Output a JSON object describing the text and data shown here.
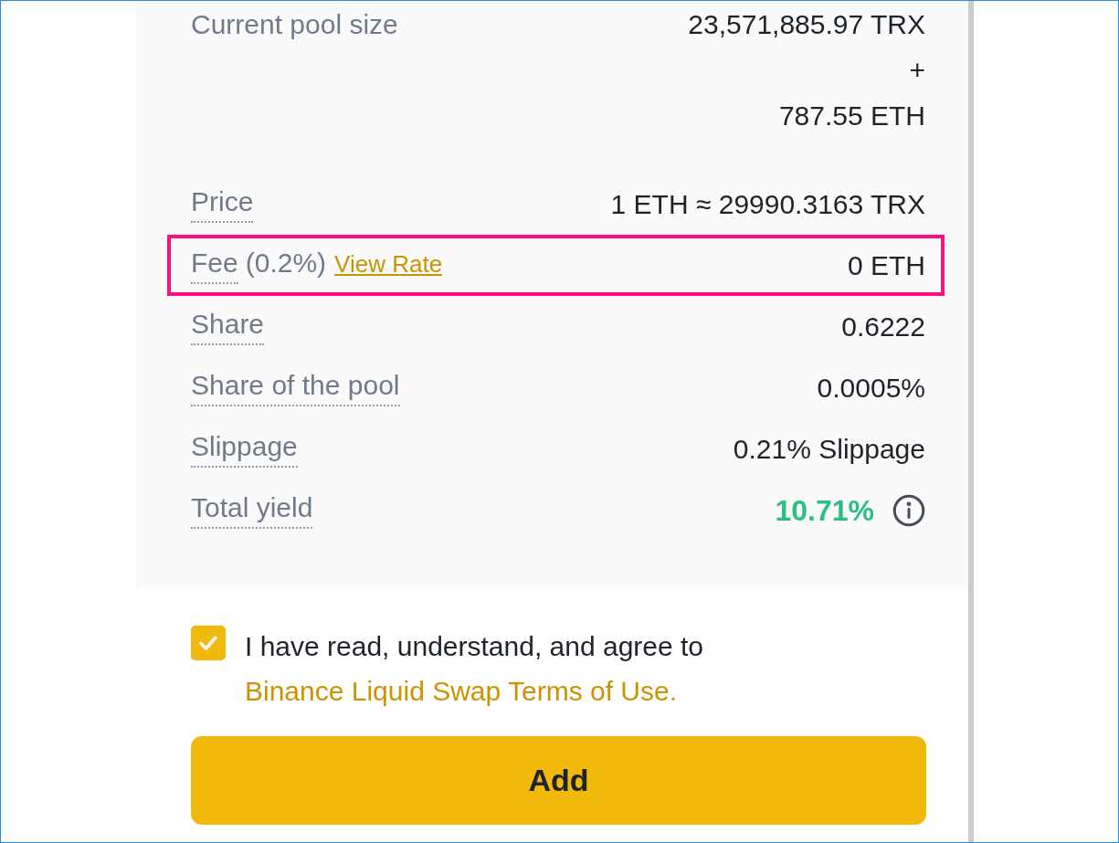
{
  "pool_size": {
    "label": "Current pool size",
    "lines": [
      "23,571,885.97 TRX",
      "+",
      "787.55 ETH"
    ]
  },
  "rows": [
    {
      "kind": "plain",
      "label": "Price",
      "value": "1 ETH ≈ 29990.3163 TRX",
      "highlighted": false
    },
    {
      "kind": "plain",
      "label": "Fee",
      "note": "(0.2%)",
      "link": "View Rate",
      "value": "0 ETH",
      "highlighted": true
    },
    {
      "kind": "plain",
      "label": "Share",
      "value": "0.6222",
      "highlighted": false
    },
    {
      "kind": "plain",
      "label": "Share of the pool",
      "value": "0.0005%",
      "highlighted": false
    },
    {
      "kind": "plain",
      "label": "Slippage",
      "value": "0.21% Slippage",
      "highlighted": false
    },
    {
      "kind": "yield",
      "label": "Total yield",
      "value": "10.71%",
      "highlighted": false
    }
  ],
  "agreement": {
    "checked": true,
    "text": "I have read, understand, and agree to",
    "link": "Binance Liquid Swap Terms of Use."
  },
  "button": "Add"
}
